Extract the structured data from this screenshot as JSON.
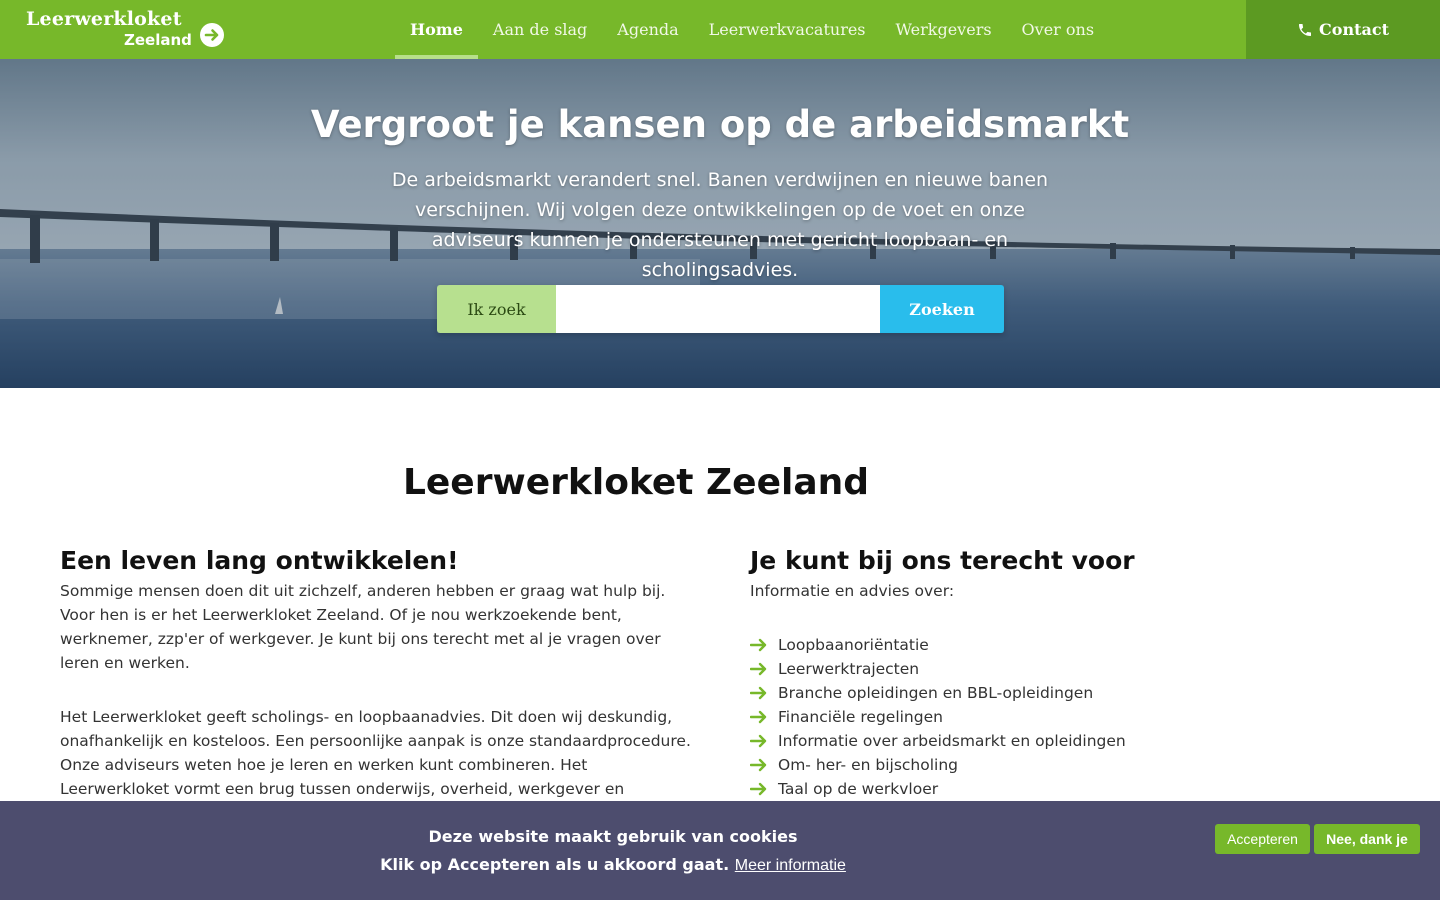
{
  "header": {
    "logo_line1": "Leerwerkloket",
    "logo_line2": "Zeeland",
    "nav": [
      {
        "label": "Home",
        "active": true
      },
      {
        "label": "Aan de slag"
      },
      {
        "label": "Agenda"
      },
      {
        "label": "Leerwerkvacatures"
      },
      {
        "label": "Werkgevers"
      },
      {
        "label": "Over ons"
      }
    ],
    "contact_label": "Contact",
    "contact_icon": "phone-icon"
  },
  "hero": {
    "title": "Vergroot je kansen op de arbeidsmarkt",
    "text": "De arbeidsmarkt verandert snel. Banen verdwijnen en nieuwe banen verschijnen. Wij volgen deze ontwikkelingen op de voet en onze adviseurs kunnen je ondersteunen met gericht loopbaan- en scholingsadvies.",
    "search_label": "Ik zoek",
    "search_value": "",
    "search_button": "Zoeken"
  },
  "main": {
    "title": "Leerwerkloket Zeeland",
    "left": {
      "heading": "Een leven lang ontwikkelen!",
      "paragraphs": [
        "Sommige mensen doen dit uit zichzelf, anderen hebben er graag wat hulp bij. Voor hen is er het Leerwerkloket Zeeland. Of je nou werkzoekende bent, werknemer, zzp'er of werkgever. Je kunt bij ons terecht met al je vragen over leren en werken.",
        "Het Leerwerkloket geeft scholings- en loopbaanadvies. Dit doen wij deskundig, onafhankelijk en kosteloos.  Een persoonlijke aanpak is onze standaardprocedure. Onze adviseurs weten hoe je leren en werken kunt combineren. Het Leerwerkloket vormt een brug tussen onderwijs, overheid, werkgever en werknemer.\nWie je ook bent en wat je vraag ook is: wij zijn er voor jou!"
      ]
    },
    "right": {
      "heading": "Je kunt bij ons terecht voor",
      "intro": "Informatie en advies over:",
      "items": [
        "Loopbaanoriëntatie",
        "Leerwerktrajecten",
        "Branche opleidingen en BBL-opleidingen",
        "Financiële regelingen",
        "Informatie over arbeidsmarkt en opleidingen",
        "Om- her- en bijscholing",
        "Taal op de werkvloer"
      ]
    }
  },
  "cookie": {
    "line1": "Deze website maakt gebruik van cookies",
    "line2": "Klik op Accepteren als u akkoord gaat.",
    "more": "Meer informatie",
    "accept": "Accepteren",
    "decline": "Nee, dank je"
  },
  "colors": {
    "brand_green": "#77b82a",
    "contact_green": "#5c9a22",
    "search_button": "#29bdec",
    "cookie_bar": "#4d4d6e"
  }
}
